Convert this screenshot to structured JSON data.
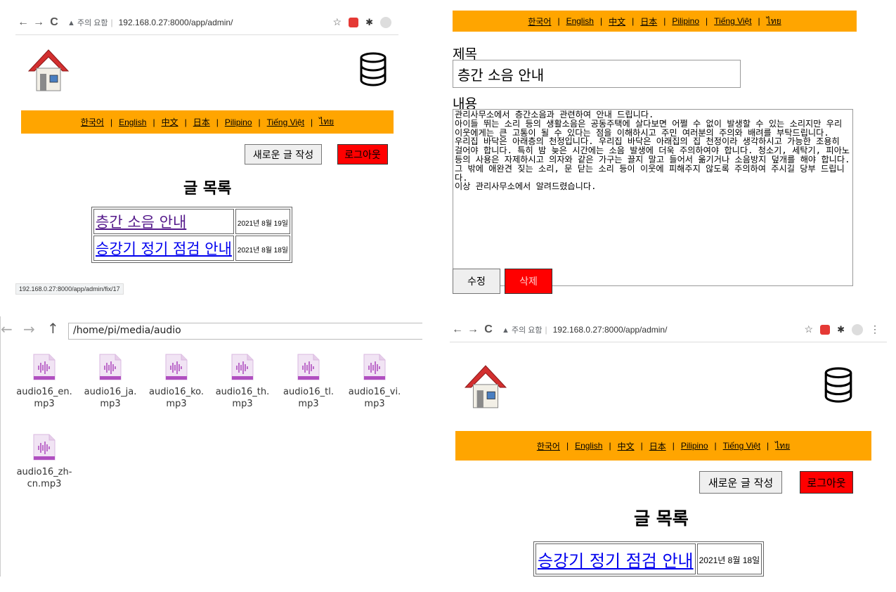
{
  "panel_a": {
    "chrome": {
      "back": "←",
      "forward": "→",
      "reload": "C",
      "warning": "▲ 주의 요함",
      "url": "192.168.0.27:8000/app/admin/"
    },
    "lang_items": [
      "한국어",
      "English",
      "中文",
      "日本",
      "Pilipino",
      "Tiếng Việt",
      "ไทย"
    ],
    "new_post": "새로운 글 작성",
    "logout": "로그아웃",
    "heading": "글 목록",
    "rows": [
      {
        "title": "층간 소음 안내",
        "date": "2021년 8월 19일"
      },
      {
        "title": "승강기 정기 점검 안내",
        "date": "2021년 8월 18일"
      }
    ],
    "status_url": "192.168.0.27:8000/app/admin/fix/17"
  },
  "panel_b": {
    "lang_items": [
      "한국어",
      "English",
      "中文",
      "日本",
      "Pilipino",
      "Tiếng Việt",
      "ไทย"
    ],
    "title_label": "제목",
    "title_value": "층간 소음 안내",
    "content_label": "내용",
    "content_lines": [
      "관리사무소에서 층간소음과 관련하여 안내 드립니다.",
      "아이들 뛰는 소리 등의 생활소음은 공동주택에 살다보면 어쩔 수 없이 발생할 수 있는 소리지만 우리 이웃에게는 큰 고통이 될 수 있다는 점을 이해하시고 주민 여러분의 주의와 배려를 부탁드립니다.",
      "우리집 바닥은 아래층의 천정입니다. 우리집 바닥은 아래집의 집 천정이라 생각하시고 가능한 조용히 걸어야 합니다. 특히 밤 늦은 시간에는 소음 발생에 더욱 주의하여야 합니다. 청소기, 세탁기, 피아노 등의 사용은 자제하시고 의자와 같은 가구는 끌지 말고 들어서 옮기거나 소음방지 덮개를 해야 합니다. 그 밖에 애완견 짖는 소리, 문 닫는 소리 등이 이웃에 피해주지 않도록 주의하여 주시길 당부 드립니다.",
      "이상 관리사무소에서 알려드렸습니다."
    ],
    "edit": "수정",
    "delete": "삭제"
  },
  "panel_c": {
    "nav_back": "←",
    "nav_forward": "→",
    "nav_up": "↑",
    "path": "/home/pi/media/audio",
    "files": [
      {
        "line1": "audio16_en.",
        "line2": "mp3"
      },
      {
        "line1": "audio16_ja.",
        "line2": "mp3"
      },
      {
        "line1": "audio16_ko.",
        "line2": "mp3"
      },
      {
        "line1": "audio16_th.",
        "line2": "mp3"
      },
      {
        "line1": "audio16_tl.",
        "line2": "mp3"
      },
      {
        "line1": "audio16_vi.",
        "line2": "mp3"
      },
      {
        "line1": "audio16_zh-",
        "line2": "cn.mp3"
      }
    ]
  },
  "panel_d": {
    "chrome": {
      "back": "←",
      "forward": "→",
      "reload": "C",
      "warning": "▲ 주의 요함",
      "url": "192.168.0.27:8000/app/admin/"
    },
    "lang_items": [
      "한국어",
      "English",
      "中文",
      "日本",
      "Pilipino",
      "Tiếng Việt",
      "ไทย"
    ],
    "new_post": "새로운 글 작성",
    "logout": "로그아웃",
    "heading": "글 목록",
    "rows": [
      {
        "title": "승강기 정기 점검 안내",
        "date": "2021년 8월 18일"
      }
    ]
  },
  "colors": {
    "lang_bar": "#ffa500",
    "red_button": "#ff0000",
    "link": "#0000ee",
    "visited": "#551a8b"
  }
}
